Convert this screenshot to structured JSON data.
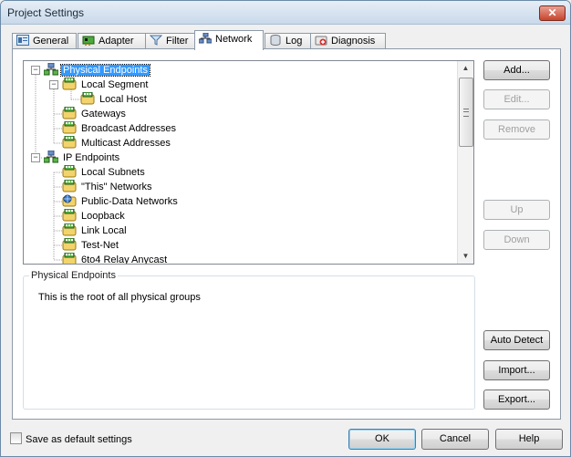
{
  "window": {
    "title": "Project Settings",
    "close_glyph": "✕"
  },
  "tabs": [
    {
      "label": "General",
      "icon": "general-icon"
    },
    {
      "label": "Adapter",
      "icon": "adapter-icon"
    },
    {
      "label": "Filter",
      "icon": "filter-icon"
    },
    {
      "label": "Network",
      "icon": "network-icon",
      "active": true
    },
    {
      "label": "Log",
      "icon": "log-icon"
    },
    {
      "label": "Diagnosis",
      "icon": "diagnosis-icon"
    }
  ],
  "tree": {
    "items": [
      {
        "label": "Physical Endpoints",
        "expander": "−",
        "icon": "physical-endpoints-icon",
        "selected": true
      },
      {
        "label": "Local Segment",
        "expander": "−",
        "icon": "local-segment-icon"
      },
      {
        "label": "Local Host",
        "icon": "local-host-icon"
      },
      {
        "label": "Gateways",
        "icon": "gateways-icon"
      },
      {
        "label": "Broadcast Addresses",
        "icon": "broadcast-icon"
      },
      {
        "label": "Multicast Addresses",
        "icon": "multicast-icon"
      },
      {
        "label": "IP Endpoints",
        "expander": "−",
        "icon": "ip-endpoints-icon"
      },
      {
        "label": "Local Subnets",
        "icon": "subnet-icon"
      },
      {
        "label": "\"This\" Networks",
        "icon": "subnet-icon"
      },
      {
        "label": "Public-Data Networks",
        "icon": "public-network-icon"
      },
      {
        "label": "Loopback",
        "icon": "subnet-icon"
      },
      {
        "label": "Link Local",
        "icon": "subnet-icon"
      },
      {
        "label": "Test-Net",
        "icon": "subnet-icon"
      },
      {
        "label": "6to4 Relay Anycast",
        "icon": "subnet-icon"
      }
    ]
  },
  "description": {
    "title": "Physical Endpoints",
    "text": "This is the root of all physical groups"
  },
  "side_buttons": {
    "add": "Add...",
    "edit": "Edit...",
    "remove": "Remove",
    "up": "Up",
    "down": "Down",
    "auto_detect": "Auto Detect",
    "import": "Import...",
    "export": "Export..."
  },
  "footer": {
    "save_default": "Save as default settings",
    "ok": "OK",
    "cancel": "Cancel",
    "help": "Help"
  },
  "colors": {
    "selection": "#3399ff",
    "title_gradient_top": "#e6eef6",
    "close_red": "#c7452e"
  }
}
